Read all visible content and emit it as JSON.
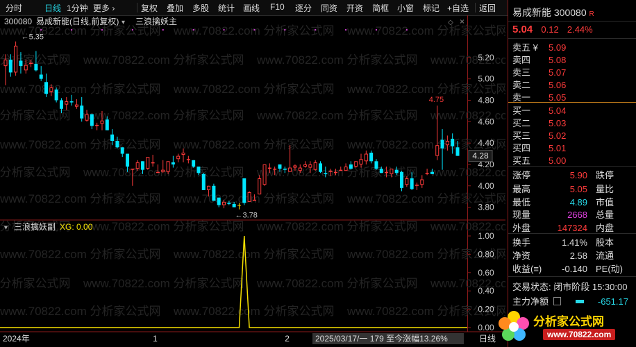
{
  "toolbar": {
    "items": [
      "分时",
      "日线",
      "1分钟",
      "更多 ›",
      "复权",
      "叠加",
      "多股",
      "统计",
      "画线",
      "F10",
      "逐分",
      "同资",
      "开资",
      "简框",
      "小窗",
      "标记",
      "+自选",
      "返回"
    ]
  },
  "header": {
    "code": "300080",
    "name": "易成新能",
    "mode": "(日线,前复权)",
    "indicator_main": "三浪擒妖主",
    "indicator_sub": "三浪擒妖副",
    "xg_label": "XG: 0.00",
    "max_marker": "5.35",
    "min_marker": "3.78",
    "peak_label": "4.75",
    "last_price_tag": "4.28"
  },
  "watermark": "www.70822.com 分析家公式网",
  "footer": {
    "year_label": "2024年",
    "m1": "1",
    "m2": "2",
    "info": "2025/03/17/一 179 至今涨幅13.26%",
    "end": "日线"
  },
  "quote": {
    "title": "易成新能 300080",
    "badge": "R",
    "price": "5.04",
    "change": "0.12",
    "pct": "2.44%",
    "asks": [
      {
        "label": "卖五 ¥",
        "price": "5.09"
      },
      {
        "label": "卖四",
        "price": "5.08"
      },
      {
        "label": "卖三",
        "price": "5.07"
      },
      {
        "label": "卖二",
        "price": "5.06"
      },
      {
        "label": "卖一",
        "price": "5.05"
      }
    ],
    "bids": [
      {
        "label": "买一",
        "price": "5.04"
      },
      {
        "label": "买二",
        "price": "5.03"
      },
      {
        "label": "买三",
        "price": "5.02"
      },
      {
        "label": "买四",
        "price": "5.01"
      },
      {
        "label": "买五",
        "price": "5.00"
      }
    ],
    "stats": [
      {
        "k": "涨停",
        "v": "5.90",
        "k2": "跌停"
      },
      {
        "k": "最高",
        "v": "5.05",
        "k2": "量比"
      },
      {
        "k": "最低",
        "v": "4.89",
        "k2": "市值"
      },
      {
        "k": "现量",
        "v": "2668",
        "k2": "总量"
      },
      {
        "k": "外盘",
        "v": "147324",
        "k2": "内盘"
      },
      {
        "k": "换手",
        "v": "1.41%",
        "k2": "股本"
      },
      {
        "k": "净资",
        "v": "2.58",
        "k2": "流通"
      },
      {
        "k": "收益(≡)",
        "v": "-0.140",
        "k2": "PE(动)"
      }
    ],
    "status_label": "交易状态: 闭市阶段 15:30:00",
    "net_label": "主力净额",
    "net_value": "-651.17"
  },
  "logo": {
    "text1": "分析家公式网",
    "text2": "www.70822.com"
  },
  "colors": {
    "up": "#ff3b3b",
    "down": "#00e5ff",
    "xg": "#f5e000",
    "flag": "#ffd400"
  },
  "chart_data": [
    {
      "type": "candlestick",
      "title": "300080 易成新能(日线,前复权)",
      "ylabel": "",
      "ylim": [
        3.7,
        5.4
      ],
      "yticks": [
        3.8,
        4.0,
        4.2,
        4.4,
        4.6,
        4.8,
        5.0,
        5.2
      ],
      "x_markers": [
        "2024年",
        "1",
        "2"
      ],
      "series": [
        {
          "values": [
            [
              5.12,
              5.23,
              4.94,
              5.18
            ],
            [
              5.18,
              5.23,
              5.02,
              5.06
            ],
            [
              5.06,
              5.35,
              5.03,
              5.31
            ],
            [
              5.17,
              5.25,
              5.05,
              5.12
            ],
            [
              5.08,
              5.18,
              5.05,
              5.13
            ],
            [
              5.14,
              5.18,
              5.11,
              5.15
            ],
            [
              5.14,
              5.26,
              5.07,
              5.08
            ],
            [
              5.04,
              5.12,
              4.98,
              5.0
            ],
            [
              4.97,
              5.05,
              4.83,
              4.86
            ],
            [
              4.88,
              4.95,
              4.84,
              4.92
            ],
            [
              4.9,
              4.92,
              4.78,
              4.8
            ],
            [
              4.8,
              4.82,
              4.68,
              4.72
            ],
            [
              4.76,
              4.83,
              4.71,
              4.79
            ],
            [
              4.79,
              4.85,
              4.75,
              4.78
            ],
            [
              4.74,
              4.81,
              4.72,
              4.76
            ],
            [
              4.75,
              4.83,
              4.6,
              4.63
            ],
            [
              4.61,
              4.71,
              4.6,
              4.67
            ],
            [
              4.67,
              4.67,
              4.53,
              4.56
            ],
            [
              4.56,
              4.59,
              4.52,
              4.57
            ],
            [
              4.58,
              4.7,
              4.52,
              4.61
            ],
            [
              4.62,
              4.65,
              4.52,
              4.52
            ],
            [
              4.48,
              4.53,
              4.38,
              4.42
            ],
            [
              4.42,
              4.46,
              4.35,
              4.36
            ],
            [
              4.36,
              4.36,
              4.27,
              4.3
            ],
            [
              4.3,
              4.3,
              4.13,
              4.18
            ],
            [
              4.16,
              4.16,
              4.0,
              4.16
            ],
            [
              4.16,
              4.24,
              4.14,
              4.22
            ],
            [
              4.23,
              4.23,
              4.11,
              4.15
            ],
            [
              4.16,
              4.27,
              4.15,
              4.27
            ],
            [
              4.22,
              4.29,
              4.18,
              4.22
            ],
            [
              4.13,
              4.2,
              4.13,
              4.13
            ],
            [
              4.13,
              4.24,
              4.12,
              4.15
            ],
            [
              4.13,
              4.23,
              4.11,
              4.23
            ],
            [
              4.22,
              4.28,
              4.17,
              4.2
            ],
            [
              4.25,
              4.3,
              4.22,
              4.28
            ],
            [
              4.29,
              4.35,
              4.22,
              4.31
            ],
            [
              4.24,
              4.28,
              4.21,
              4.25
            ],
            [
              4.24,
              4.24,
              4.17,
              4.18
            ],
            [
              4.18,
              4.18,
              4.1,
              4.12
            ],
            [
              4.11,
              4.12,
              3.96,
              3.96
            ],
            [
              3.96,
              4.0,
              3.9,
              4.0
            ],
            [
              4.0,
              4.02,
              3.86,
              3.86
            ],
            [
              3.89,
              3.89,
              3.8,
              3.82
            ],
            [
              3.82,
              3.87,
              3.79,
              3.85
            ],
            [
              3.84,
              3.86,
              3.82,
              3.83
            ],
            [
              3.83,
              3.85,
              3.8,
              3.8
            ],
            [
              3.82,
              3.84,
              3.78,
              3.82
            ],
            [
              4.07,
              4.07,
              3.82,
              3.84
            ],
            [
              3.85,
              3.95,
              3.85,
              3.94
            ],
            [
              3.87,
              3.92,
              3.87,
              3.87
            ],
            [
              3.92,
              4.1,
              3.92,
              4.07
            ],
            [
              4.01,
              4.2,
              4.0,
              4.2
            ],
            [
              4.16,
              4.21,
              4.12,
              4.17
            ],
            [
              4.16,
              4.18,
              4.1,
              4.16
            ],
            [
              4.2,
              4.2,
              4.13,
              4.16
            ],
            [
              4.16,
              4.18,
              4.12,
              4.15
            ],
            [
              4.13,
              4.38,
              4.13,
              4.17
            ],
            [
              4.17,
              4.2,
              4.14,
              4.19
            ],
            [
              4.14,
              4.2,
              4.12,
              4.17
            ],
            [
              4.18,
              4.23,
              4.17,
              4.2
            ],
            [
              4.17,
              4.23,
              4.12,
              4.2
            ],
            [
              4.15,
              4.24,
              4.14,
              4.22
            ],
            [
              4.21,
              4.23,
              4.12,
              4.13
            ],
            [
              4.12,
              4.18,
              4.08,
              4.11
            ],
            [
              4.13,
              4.16,
              4.09,
              4.14
            ],
            [
              4.12,
              4.16,
              4.1,
              4.13
            ],
            [
              4.15,
              4.18,
              4.14,
              4.15
            ],
            [
              4.14,
              4.21,
              4.14,
              4.18
            ],
            [
              4.2,
              4.23,
              4.15,
              4.16
            ],
            [
              4.18,
              4.23,
              4.17,
              4.23
            ],
            [
              4.2,
              4.3,
              4.17,
              4.25
            ],
            [
              4.23,
              4.33,
              4.2,
              4.3
            ],
            [
              4.31,
              4.33,
              4.21,
              4.23
            ],
            [
              4.23,
              4.25,
              4.15,
              4.16
            ],
            [
              4.16,
              4.18,
              4.12,
              4.12
            ],
            [
              4.12,
              4.18,
              4.08,
              4.13
            ],
            [
              4.11,
              4.16,
              4.08,
              4.16
            ],
            [
              4.15,
              4.18,
              4.1,
              4.12
            ],
            [
              4.13,
              4.14,
              3.95,
              3.98
            ],
            [
              4.01,
              4.09,
              3.99,
              4.07
            ],
            [
              4.07,
              4.13,
              3.96,
              3.97
            ],
            [
              4.0,
              4.03,
              3.96,
              4.01
            ],
            [
              4.01,
              4.1,
              3.98,
              4.06
            ],
            [
              4.11,
              4.16,
              4.1,
              4.12
            ],
            [
              4.13,
              4.16,
              4.11,
              4.11
            ],
            [
              4.28,
              4.75,
              4.24,
              4.38
            ],
            [
              4.43,
              4.53,
              4.15,
              4.35
            ],
            [
              4.38,
              4.47,
              4.33,
              4.42
            ],
            [
              4.44,
              4.49,
              4.3,
              4.37
            ],
            [
              4.36,
              4.42,
              4.28,
              4.28
            ]
          ]
        }
      ]
    },
    {
      "type": "line",
      "title": "三浪擒妖副",
      "ylabel": "",
      "ylim": [
        0,
        1
      ],
      "yticks": [
        0.0,
        0.2,
        0.4,
        0.6,
        0.8,
        1.0
      ],
      "series": [
        {
          "name": "XG",
          "values": [
            0,
            0,
            0,
            0,
            0,
            0,
            0,
            0,
            0,
            0,
            0,
            0,
            0,
            0,
            0,
            0,
            0,
            0,
            0,
            0,
            0,
            0,
            0,
            0,
            0,
            0,
            0,
            0,
            0,
            0,
            0,
            0,
            0,
            0,
            0,
            0,
            0,
            0,
            0,
            0,
            0,
            0,
            0,
            0,
            0,
            0,
            0,
            1,
            0,
            0,
            0,
            0,
            0,
            0,
            0,
            0,
            0,
            0,
            0,
            0,
            0,
            0,
            0,
            0,
            0,
            0,
            0,
            0,
            0,
            0,
            0,
            0,
            0,
            0,
            0,
            0,
            0,
            0,
            0,
            0,
            0,
            0,
            0,
            0,
            0,
            0,
            0,
            0,
            0,
            0
          ]
        }
      ]
    }
  ]
}
